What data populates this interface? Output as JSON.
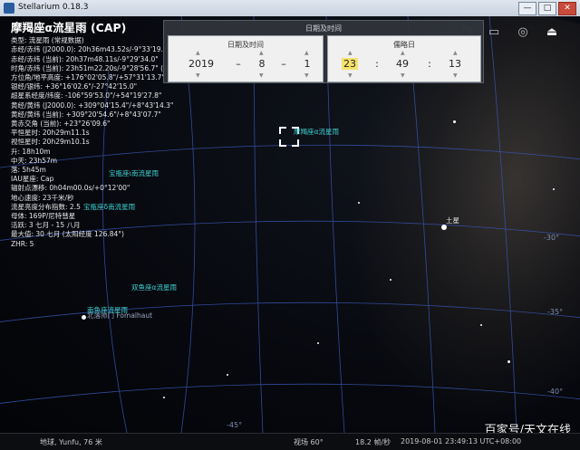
{
  "window": {
    "title": "Stellarium 0.18.3",
    "min": "—",
    "max": "□",
    "close": "✕"
  },
  "info": {
    "header": "摩羯座α流星雨 (CAP)",
    "lines": [
      "类型: 流星雨 (常规数据)",
      "赤经/赤纬 (J2000.0): 20h36m43.52s/-9°33'19.5\"",
      "赤经/赤纬 (当前): 20h37m48.11s/-9°29'34.0\"",
      "时角/赤纬 (当前): 23h51m22.20s/-9°28'56.7\" (视在)",
      "方位角/地平高度: +176°02'05.8\"/+57°31'13.7\" (视在)",
      "银经/银纬: +36°16'02.6\"/-27°42'15.0\"",
      "超星系经度/纬度: -106°59'53.0\"/+54°19'27.8\"",
      "黄经/黄纬 (J2000.0): +309°04'15.4\"/+8°43'14.3\"",
      "黄经/黄纬 (当前): +309°20'54.6\"/+8°43'07.7\"",
      "黄赤交角 (当前): +23°26'09.6\"",
      "平恒星时: 20h29m11.1s",
      "视恒星时: 20h29m10.1s",
      "升: 18h10m",
      "中天: 23h57m",
      "落: 5h45m",
      "IAU星座: Cap",
      "辐射点漂移: 0h04m00.0s/+0°12'00\"",
      "地心速度: 23千米/秒",
      "流星亮度分布指数: 2.5",
      "母体: 169P/尼特彗星",
      "活跃: 3 七月 - 15 八月",
      "最大值: 30 七月 (太阳经度 126.84°)",
      "ZHR: 5"
    ]
  },
  "datetime": {
    "panel_title": "日期及时间",
    "date_title": "日期及时间",
    "time_title": "儒略日",
    "year": "2019",
    "month": "8",
    "day": "1",
    "hour": "23",
    "minute": "49",
    "second": "13",
    "date_sep": "–",
    "time_sep": ":"
  },
  "toolbar": {
    "icons": [
      "square-icon",
      "rectangle-icon",
      "target-icon",
      "exit-icon"
    ]
  },
  "labels": {
    "selected": "摩羯座α流星雨",
    "shower1": "宝瓶座ι南流星雨",
    "shower2": "宝瓶座δ南流星雨",
    "shower3": "双鱼座α流星雨",
    "shower4": "南鱼座流星雨",
    "star_fomalhaut": "北落师门 Fomalhaut",
    "saturn": "土星"
  },
  "grid_labels": [
    "-30°",
    "-35°",
    "-40°",
    "-45°"
  ],
  "status": {
    "location": "地球, Yunfu, 76 米",
    "fov": "视场 60°",
    "fps": "18.2 帧/秒",
    "datetime": "2019-08-01 23:49:13 UTC+08:00"
  },
  "watermark": "百家号/天文在线"
}
